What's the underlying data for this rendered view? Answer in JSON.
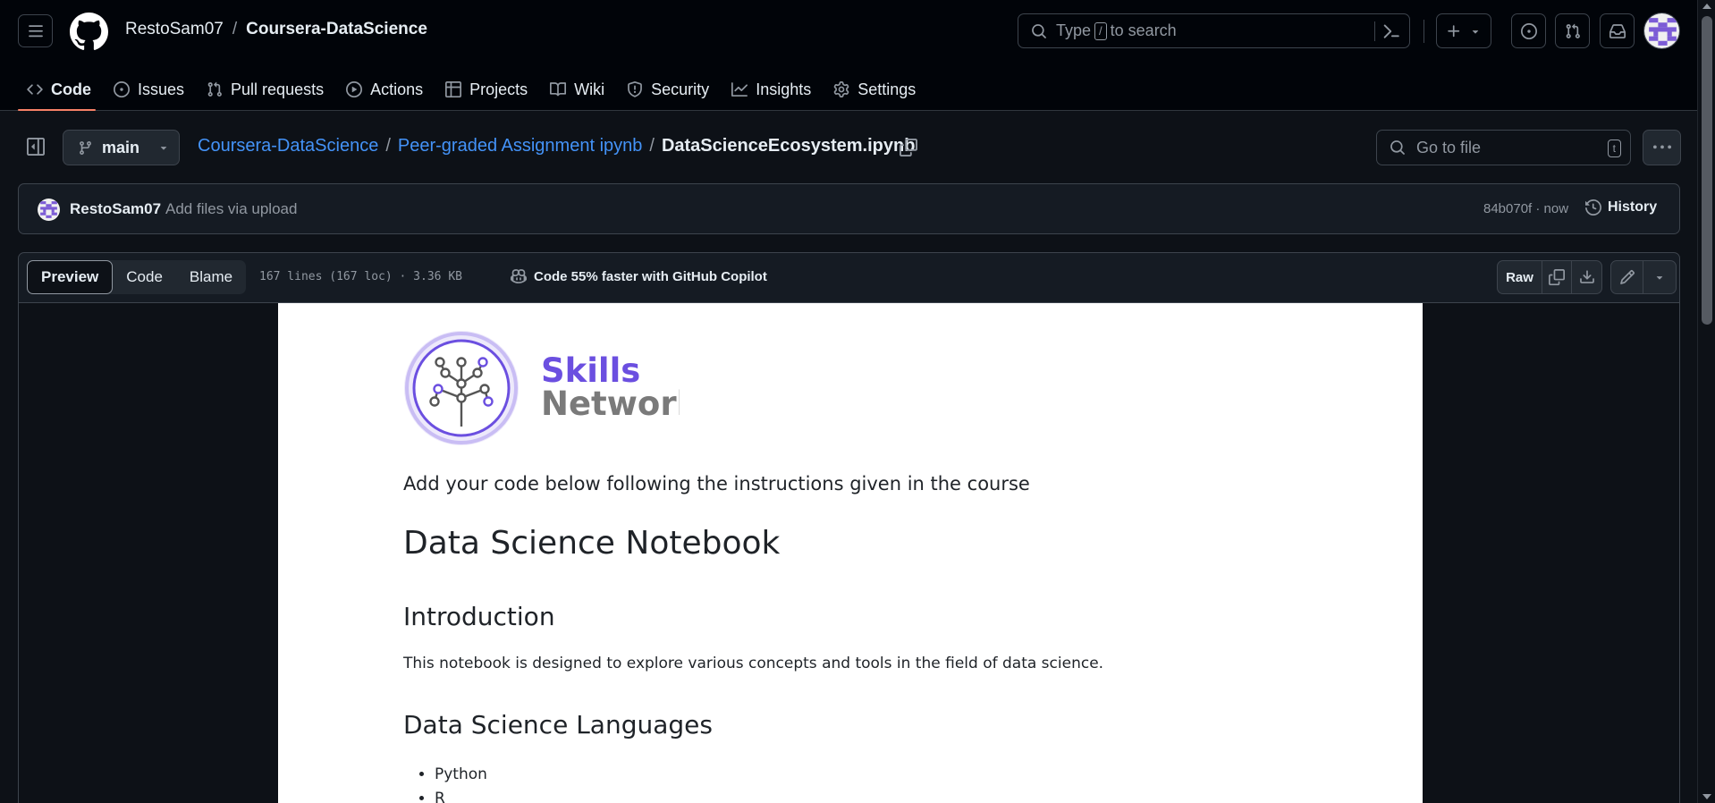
{
  "header": {
    "owner": "RestoSam07",
    "separator": "/",
    "repo": "Coursera-DataScience",
    "search_prefix": "Type",
    "search_key": "/",
    "search_suffix": "to search"
  },
  "repo_nav": {
    "code": "Code",
    "issues": "Issues",
    "pull_requests": "Pull requests",
    "actions": "Actions",
    "projects": "Projects",
    "wiki": "Wiki",
    "security": "Security",
    "insights": "Insights",
    "settings": "Settings"
  },
  "file_header": {
    "branch": "main",
    "path_root": "Coursera-DataScience",
    "path_sep": "/",
    "path_folder": "Peer-graded Assignment ipynb",
    "file_name": "DataScienceEcosystem.ipynb",
    "goto_placeholder": "Go to file",
    "goto_key": "t"
  },
  "commit": {
    "author": "RestoSam07",
    "message": "Add files via upload",
    "sha_time": "84b070f · now",
    "history_label": "History"
  },
  "file_toolbar": {
    "tabs": [
      "Preview",
      "Code",
      "Blame"
    ],
    "active_tab": "Preview",
    "info": "167 lines (167 loc) · 3.36 KB",
    "copilot": "Code 55% faster with GitHub Copilot",
    "raw": "Raw"
  },
  "notebook": {
    "logo_word1": "Skills",
    "logo_word2": "Network",
    "logo_color_primary": "#6b4fe0",
    "logo_color_secondary": "#7a7a7a",
    "intro": "Add your code below following the instructions given in the course",
    "title": "Data Science Notebook",
    "intro_heading": "Introduction",
    "intro_text": "This notebook is designed to explore various concepts and tools in the field of data science.",
    "languages_heading": "Data Science Languages",
    "languages": [
      "Python",
      "R"
    ]
  },
  "colors": {
    "bg": "#0d1117",
    "header_bg": "#010409",
    "link": "#4493f8",
    "active_underline": "#f78166"
  }
}
